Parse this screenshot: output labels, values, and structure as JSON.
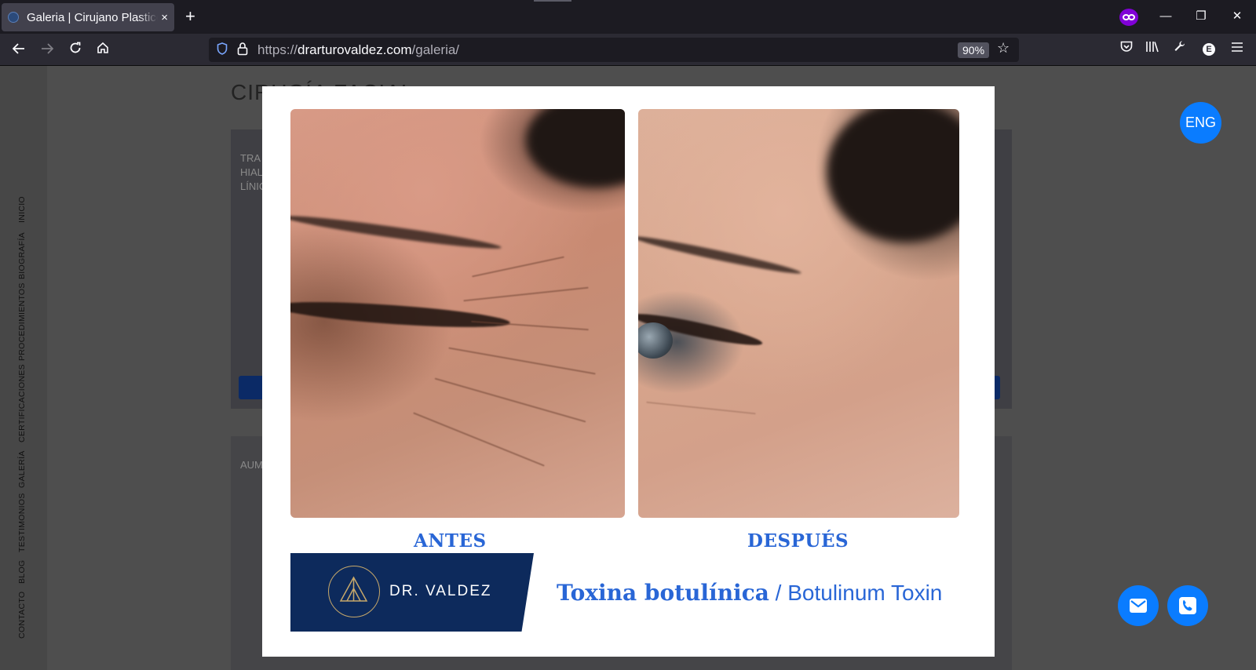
{
  "browser": {
    "tab_title": "Galeria | Cirujano Plastico",
    "tab_close": "×",
    "new_tab": "+",
    "url_scheme": "https://",
    "url_host": "drarturovaldez.com",
    "url_path": "/galeria/",
    "zoom": "90%",
    "icons": [
      "back-icon",
      "forward-icon",
      "reload-icon",
      "home-icon",
      "shield-icon",
      "lock-icon",
      "bookmark-star-icon",
      "pocket-icon",
      "library-icon",
      "wrench-icon",
      "extension-icon",
      "menu-icon",
      "private-browsing-icon"
    ],
    "extension_letter": "E"
  },
  "sidebar": {
    "items": [
      "INICIO",
      "BIOGRAFÍA",
      "PROCEDIMIENTOS",
      "CERTIFICACIONES",
      "GALERÍA",
      "TESTIMONIOS",
      "BLOG",
      "CONTACTO"
    ]
  },
  "page": {
    "section_title": "CIRUGÍA FACIAL",
    "card1_text": [
      "TRA",
      "HIAL",
      "LÍNIC"
    ],
    "card2_text": "AUM",
    "lang_button": "ENG",
    "accent_color": "#0a7cff"
  },
  "modal": {
    "before_label": "ANTES",
    "after_label": "DESPUÉS",
    "brand_name": "DR. VALDEZ",
    "treatment_es": "Toxina botulínica",
    "separator": " / ",
    "treatment_en": "Botulinum Toxin",
    "brand_color": "#0d2a5c",
    "caption_color": "#2966d6"
  }
}
